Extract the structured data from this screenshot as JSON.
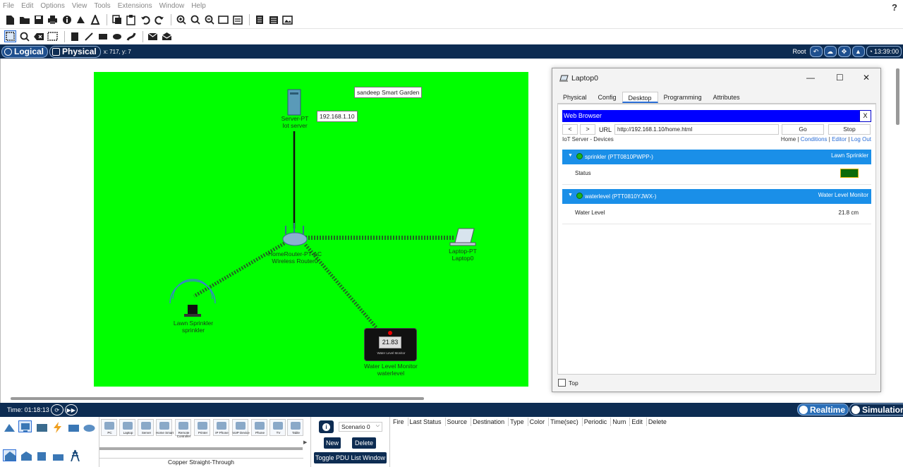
{
  "menu": [
    "File",
    "Edit",
    "Options",
    "View",
    "Tools",
    "Extensions",
    "Window",
    "Help"
  ],
  "help_label": "?",
  "nav": {
    "logical_label": "Logical",
    "physical_label": "Physical",
    "coords": "x: 717, y: 7",
    "root_label": "Root",
    "clock": "13:39:00"
  },
  "workspace": {
    "note_label": "sandeep Smart Garden",
    "ip_label": "192.168.1.10",
    "server": {
      "type": "Server-PT",
      "name": "Iot server"
    },
    "router": {
      "type": "HomeRouter-PT-AC",
      "name": "Wireless Router0"
    },
    "laptop": {
      "type": "Laptop-PT",
      "name": "Laptop0"
    },
    "sprinkler": {
      "type": "Lawn Sprinkler",
      "name": "sprinkler"
    },
    "water_monitor": {
      "type": "Water Level Monitor",
      "name": "waterlevel",
      "display": "21.83",
      "caption": "Water Level Monitor"
    }
  },
  "laptop_window": {
    "title": "Laptop0",
    "controls": {
      "minimize": "—",
      "maximize": "☐",
      "close": "✕"
    },
    "tabs": [
      "Physical",
      "Config",
      "Desktop",
      "Programming",
      "Attributes"
    ],
    "active_tab": "Desktop",
    "browser": {
      "title": "Web Browser",
      "close": "X",
      "back": "<",
      "forward": ">",
      "url_label": "URL",
      "url": "http://192.168.1.10/home.html",
      "go": "Go",
      "stop": "Stop"
    },
    "iot": {
      "title": "IoT Server - Devices",
      "links": {
        "home": "Home",
        "sep1": " | ",
        "conditions": "Conditions",
        "sep2": " | ",
        "editor": "Editor",
        "sep3": " | ",
        "logout": "Log Out"
      },
      "devices": [
        {
          "caret": "▼",
          "name": "sprinkler (PTT0810PWPP-)",
          "kind": "Lawn Sprinkler",
          "prop": "Status",
          "value": ""
        },
        {
          "caret": "▼",
          "name": "waterlevel (PTT0810YJWX-)",
          "kind": "Water Level Monitor",
          "prop": "Water Level",
          "value": "21.8 cm"
        }
      ]
    },
    "top_label": "Top"
  },
  "timebar": {
    "time": "Time: 01:18:13",
    "realtime": "Realtime",
    "simulation": "Simulation"
  },
  "bottom": {
    "devices": [
      "PC",
      "Laptop",
      "Server",
      "Home Smart",
      "Remote Controller",
      "Printer",
      "IP Phone",
      "VoIP Device",
      "Phone",
      "TV",
      "Table"
    ],
    "cable_label": "Copper Straight-Through",
    "scenario": "Scenario 0",
    "new_btn": "New",
    "delete_btn": "Delete",
    "toggle_btn": "Toggle PDU List Window",
    "pdu_headers": [
      "Fire",
      "Last Status",
      "Source",
      "Destination",
      "Type",
      "Color",
      "Time(sec)",
      "Periodic",
      "Num",
      "Edit",
      "Delete"
    ]
  },
  "colors": {
    "cluster_bg": "#00ff00",
    "navbar": "#0d2c52",
    "browser_bar": "#0000ff",
    "device_bar": "#1a8fe8"
  }
}
